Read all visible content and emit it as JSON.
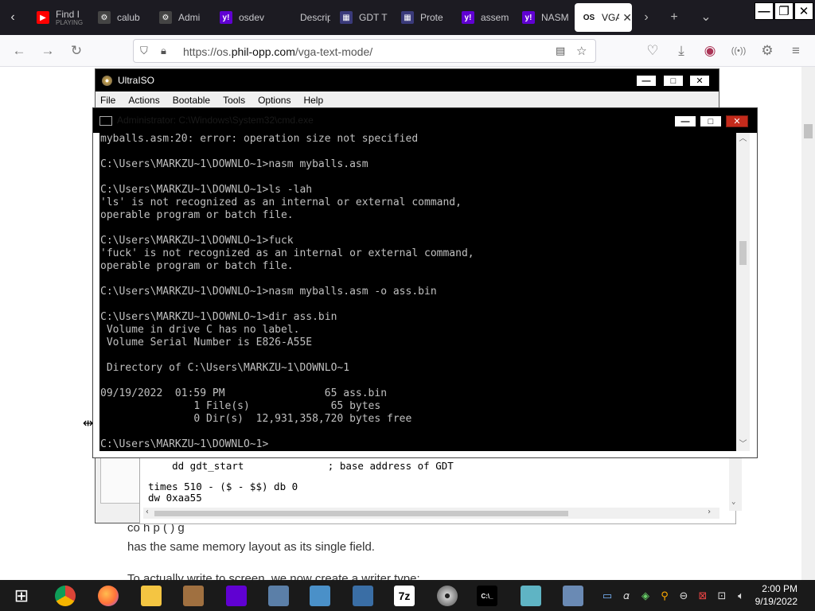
{
  "browser": {
    "tabs": [
      {
        "title": "Find I",
        "subtitle": "PLAYING",
        "favicon": "youtube-icon",
        "color": "#ff0000"
      },
      {
        "title": "calub",
        "favicon": "gear-doc-icon",
        "color": "#444444"
      },
      {
        "title": "Admi",
        "favicon": "gear-doc-icon",
        "color": "#444444"
      },
      {
        "title": "osdev",
        "favicon": "yahoo-icon",
        "color": "#6001d2"
      },
      {
        "title": "Descriptor",
        "favicon": "blank-icon",
        "color": "#1c1b22"
      },
      {
        "title": "GDT T",
        "favicon": "table-icon",
        "color": "#3a3a7a"
      },
      {
        "title": "Prote",
        "favicon": "table-icon",
        "color": "#3a3a7a"
      },
      {
        "title": "assem",
        "favicon": "yahoo-icon",
        "color": "#6001d2"
      },
      {
        "title": "NASM",
        "favicon": "yahoo-icon",
        "color": "#6001d2"
      },
      {
        "title": "VGA",
        "favicon": "os-icon",
        "color": "#ffffff",
        "active": true
      }
    ],
    "url_prefix": "https://os.",
    "url_domain": "phil-opp.com",
    "url_path": "/vga-text-mode/"
  },
  "page": {
    "line1": "co                              h                                           p (                ) g",
    "line2": "has the same memory layout as its single field.",
    "line3": "To actually write to screen, we now create a writer type:"
  },
  "ultraiso": {
    "title": "UltraISO",
    "menu": [
      "File",
      "Actions",
      "Bootable",
      "Tools",
      "Options",
      "Help"
    ],
    "asm_lines": [
      "    dd gdt_start              ; base address of GDT",
      "",
      "times 510 - ($ - $$) db 0",
      "dw 0xaa55"
    ]
  },
  "cmd": {
    "title": "Administrator: C:\\Windows\\System32\\cmd.exe",
    "lines": [
      "myballs.asm:20: error: operation size not specified",
      "",
      "C:\\Users\\MARKZU~1\\DOWNLO~1>nasm myballs.asm",
      "",
      "C:\\Users\\MARKZU~1\\DOWNLO~1>ls -lah",
      "'ls' is not recognized as an internal or external command,",
      "operable program or batch file.",
      "",
      "C:\\Users\\MARKZU~1\\DOWNLO~1>fuck",
      "'fuck' is not recognized as an internal or external command,",
      "operable program or batch file.",
      "",
      "C:\\Users\\MARKZU~1\\DOWNLO~1>nasm myballs.asm -o ass.bin",
      "",
      "C:\\Users\\MARKZU~1\\DOWNLO~1>dir ass.bin",
      " Volume in drive C has no label.",
      " Volume Serial Number is E826-A55E",
      "",
      " Directory of C:\\Users\\MARKZU~1\\DOWNLO~1",
      "",
      "09/19/2022  01:59 PM                65 ass.bin",
      "               1 File(s)             65 bytes",
      "               0 Dir(s)  12,931,358,720 bytes free",
      "",
      "C:\\Users\\MARKZU~1\\DOWNLO~1>"
    ]
  },
  "taskbar": {
    "apps": [
      {
        "name": "windows-start-icon",
        "label": "",
        "color": "#1a1a1a"
      },
      {
        "name": "chrome-icon",
        "label": "",
        "color": "#e8453c"
      },
      {
        "name": "firefox-icon",
        "label": "",
        "color": "#ff7139"
      },
      {
        "name": "file-explorer-icon",
        "label": "",
        "color": "#f4c542"
      },
      {
        "name": "app-icon",
        "label": "",
        "color": "#a07040"
      },
      {
        "name": "yahoo-messenger-icon",
        "label": "",
        "color": "#6001d2"
      },
      {
        "name": "mixer-icon",
        "label": "",
        "color": "#5b7fa8"
      },
      {
        "name": "perfmon-icon",
        "label": "",
        "color": "#4a90c8"
      },
      {
        "name": "network-icon",
        "label": "",
        "color": "#3a6ea5"
      },
      {
        "name": "7zip-icon",
        "label": "7z",
        "color": "#000000"
      },
      {
        "name": "disc-icon",
        "label": "",
        "color": "#888888"
      },
      {
        "name": "cmd-icon",
        "label": "C:\\_",
        "color": "#000000"
      },
      {
        "name": "notepad-icon",
        "label": "",
        "color": "#5fb4c4"
      },
      {
        "name": "calculator-icon",
        "label": "",
        "color": "#6a8ab4"
      }
    ],
    "time": "2:00 PM",
    "date": "9/19/2022"
  }
}
